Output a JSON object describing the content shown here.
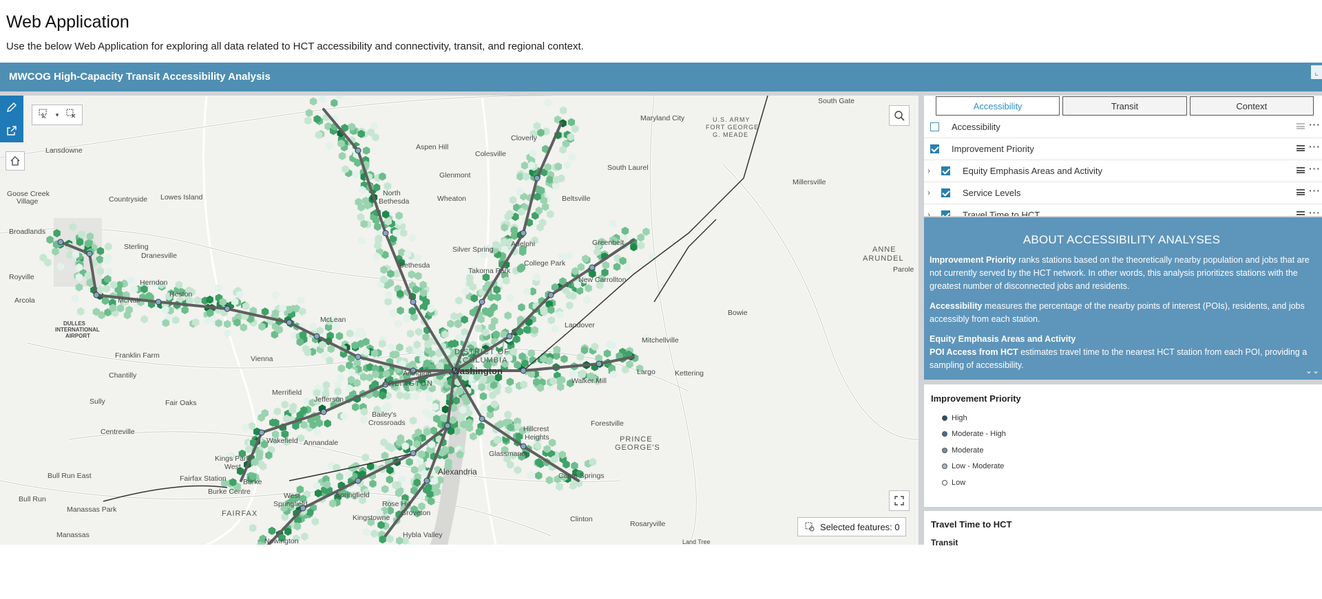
{
  "page": {
    "title": "Web Application",
    "description": "Use the below Web Application for exploring all data related to HCT accessibility and connectivity, transit, and regional context."
  },
  "app": {
    "title": "MWCOG High-Capacity Transit Accessibility Analysis",
    "accent_color": "#4e8fb3",
    "about_bg_color": "#5e95ba"
  },
  "map": {
    "labels": [
      {
        "text": "South Gate"
      },
      {
        "text": "Cloverly"
      },
      {
        "text": "U.S. ARMY"
      },
      {
        "text": "FORT GEORGE"
      },
      {
        "text": "G. MEADE"
      },
      {
        "text": "Maryland City"
      },
      {
        "text": "Lansdowne"
      },
      {
        "text": "Aspen Hill"
      },
      {
        "text": "Colesville"
      },
      {
        "text": "South Laurel"
      },
      {
        "text": "Millersville"
      },
      {
        "text": "Goose Creek"
      },
      {
        "text": "Village"
      },
      {
        "text": "Countryside"
      },
      {
        "text": "Lowes Island"
      },
      {
        "text": "Glenmont"
      },
      {
        "text": "North"
      },
      {
        "text": "Bethesda"
      },
      {
        "text": "Wheaton"
      },
      {
        "text": "Beltsville"
      },
      {
        "text": "Broadlands"
      },
      {
        "text": "Sterling"
      },
      {
        "text": "Dranesville"
      },
      {
        "text": "Silver Spring"
      },
      {
        "text": "Adelphi"
      },
      {
        "text": "Greenbelt"
      },
      {
        "text": "ANNE"
      },
      {
        "text": "ARUNDEL"
      },
      {
        "text": "Parole"
      },
      {
        "text": "Bethesda"
      },
      {
        "text": "Takoma Park"
      },
      {
        "text": "College Park"
      },
      {
        "text": "Royville"
      },
      {
        "text": "Herndon"
      },
      {
        "text": "New Carrollton"
      },
      {
        "text": "Reston"
      },
      {
        "text": "Arcola"
      },
      {
        "text": "McNair"
      },
      {
        "text": "McLean"
      },
      {
        "text": "Bowie"
      },
      {
        "text": "Landover"
      },
      {
        "text": "DULLES"
      },
      {
        "text": "INTERNATIONAL"
      },
      {
        "text": "AIRPORT"
      },
      {
        "text": "Mitchellville"
      },
      {
        "text": "Franklin Farm"
      },
      {
        "text": "Vienna"
      },
      {
        "text": "DISTRICT OF"
      },
      {
        "text": "COLUMBIA"
      },
      {
        "text": "Washington"
      },
      {
        "text": "Arlington"
      },
      {
        "text": "Largo"
      },
      {
        "text": "Chantilly"
      },
      {
        "text": "ARLINGTON"
      },
      {
        "text": "Kettering"
      },
      {
        "text": "Walker Mill"
      },
      {
        "text": "Merrifield"
      },
      {
        "text": "Sully"
      },
      {
        "text": "Fair Oaks"
      },
      {
        "text": "Jefferson"
      },
      {
        "text": "Bailey's"
      },
      {
        "text": "Crossroads"
      },
      {
        "text": "Forestville"
      },
      {
        "text": "Centreville"
      },
      {
        "text": "Hillcrest"
      },
      {
        "text": "Heights"
      },
      {
        "text": "Wakefield"
      },
      {
        "text": "Annandale"
      },
      {
        "text": "PRINCE"
      },
      {
        "text": "GEORGE'S"
      },
      {
        "text": "Kings Park"
      },
      {
        "text": "West"
      },
      {
        "text": "Glassmanor"
      },
      {
        "text": "Alexandria"
      },
      {
        "text": "Bull Run East"
      },
      {
        "text": "Fairfax Station"
      },
      {
        "text": "Burke"
      },
      {
        "text": "Camp Springs"
      },
      {
        "text": "Burke Centre"
      },
      {
        "text": "West"
      },
      {
        "text": "Springfield"
      },
      {
        "text": "Springfield"
      },
      {
        "text": "Bull Run"
      },
      {
        "text": "Rose Hill"
      },
      {
        "text": "FAIRFAX"
      },
      {
        "text": "Groveton"
      },
      {
        "text": "Manassas Park"
      },
      {
        "text": "Kingstowne"
      },
      {
        "text": "Clinton"
      },
      {
        "text": "Rosaryville"
      },
      {
        "text": "Manassas"
      },
      {
        "text": "Newington"
      },
      {
        "text": "Hybla Valley"
      },
      {
        "text": "Land Tree"
      }
    ],
    "selected_features": "Selected features: 0"
  },
  "layers": {
    "tabs": [
      {
        "label": "Accessibility",
        "active": true
      },
      {
        "label": "Transit",
        "active": false
      },
      {
        "label": "Context",
        "active": false
      }
    ],
    "items": [
      {
        "label": "Accessibility",
        "checked": false,
        "expandable": false
      },
      {
        "label": "Improvement Priority",
        "checked": true,
        "expandable": false
      },
      {
        "label": "Equity Emphasis Areas and Activity",
        "checked": true,
        "expandable": true
      },
      {
        "label": "Service Levels",
        "checked": true,
        "expandable": true
      },
      {
        "label": "Travel Time to HCT",
        "checked": true,
        "expandable": true
      }
    ]
  },
  "about": {
    "heading": "ABOUT ACCESSIBILITY ANALYSES",
    "p1_bold": "Improvement Priority",
    "p1_text": " ranks stations based on the theoretically nearby population and jobs that are not currently served by the HCT network. In other words, this analysis prioritizes stations with the greatest number of disconnected jobs and residents.",
    "p2_bold": "Accessibility",
    "p2_text": " measures the percentage of the nearby points of interest (POIs), residents, and jobs accessibly from each station.",
    "p3_bold": "Equity Emphasis Areas and Activity",
    "p4_bold": "POI Access from HCT",
    "p4_text": " estimates travel time to the nearest HCT station from each POI, providing a sampling of accessibility."
  },
  "legend": {
    "title": "Improvement Priority",
    "items": [
      {
        "label": "High",
        "color": "#1f4e79"
      },
      {
        "label": "Moderate - High",
        "color": "#3f6f94"
      },
      {
        "label": "Moderate",
        "color": "#7291ad"
      },
      {
        "label": "Low - Moderate",
        "color": "#a6b9c9"
      },
      {
        "label": "Low",
        "color": "#ffffff"
      }
    ],
    "section2_title": "Travel Time to HCT",
    "section2_sub": "Transit"
  }
}
